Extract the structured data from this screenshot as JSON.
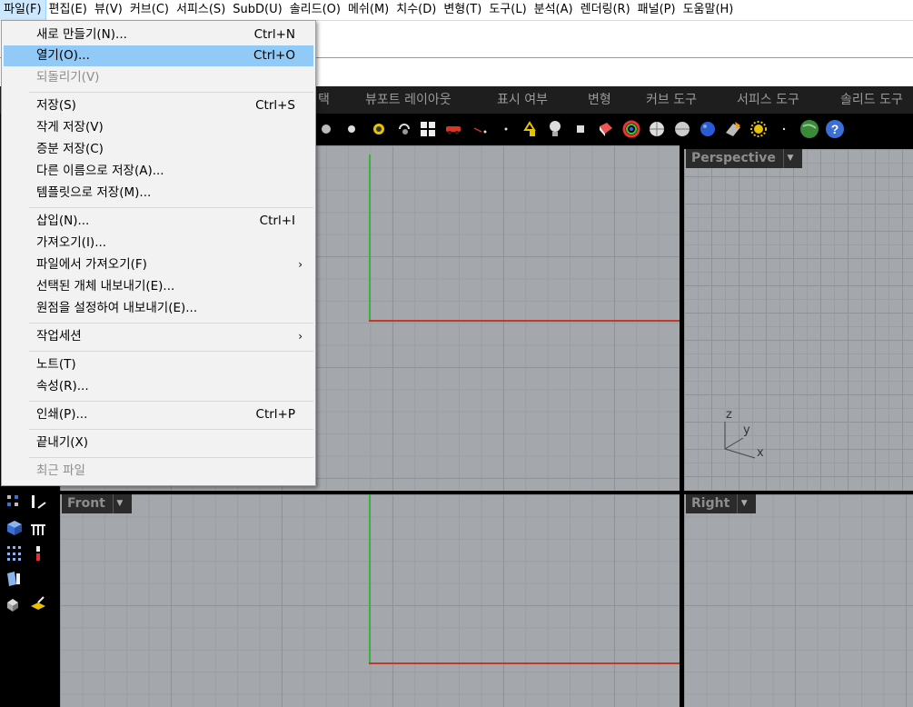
{
  "menubar": {
    "items": [
      "파일(F)",
      "편집(E)",
      "뷰(V)",
      "커브(C)",
      "서피스(S)",
      "SubD(U)",
      "솔리드(O)",
      "메쉬(M)",
      "치수(D)",
      "변형(T)",
      "도구(L)",
      "분석(A)",
      "렌더링(R)",
      "패널(P)",
      "도움말(H)"
    ]
  },
  "tabs": {
    "items": [
      "택",
      "뷰포트 레이아웃",
      "표시 여부",
      "변형",
      "커브 도구",
      "서피스 도구",
      "솔리드 도구"
    ]
  },
  "file_menu": {
    "new": "새로 만들기(N)...",
    "new_sc": "Ctrl+N",
    "open": "열기(O)...",
    "open_sc": "Ctrl+O",
    "revert": "되돌리기(V)",
    "save": "저장(S)",
    "save_sc": "Ctrl+S",
    "save_small": "작게 저장(V)",
    "incremental_save": "증분 저장(C)",
    "save_as": "다른 이름으로 저장(A)...",
    "save_template": "템플릿으로 저장(M)...",
    "insert": "삽입(N)...",
    "insert_sc": "Ctrl+I",
    "import": "가져오기(I)...",
    "import_from_file": "파일에서 가져오기(F)",
    "export_selected": "선택된 개체 내보내기(E)...",
    "export_with_origin": "원점을 설정하여 내보내기(E)...",
    "worksession": "작업세션",
    "notes": "노트(T)",
    "properties": "속성(R)...",
    "print": "인쇄(P)...",
    "print_sc": "Ctrl+P",
    "exit": "끝내기(X)",
    "recent": "최근 파일"
  },
  "viewports": {
    "perspective": "Perspective",
    "front": "Front",
    "right": "Right",
    "axis_x": "x",
    "axis_y": "y",
    "axis_z": "z"
  },
  "colors": {
    "highlight": "#91c9f7",
    "grid": "#a4a8ad",
    "x_axis": "#c0392b",
    "y_axis": "#3bb13b"
  }
}
